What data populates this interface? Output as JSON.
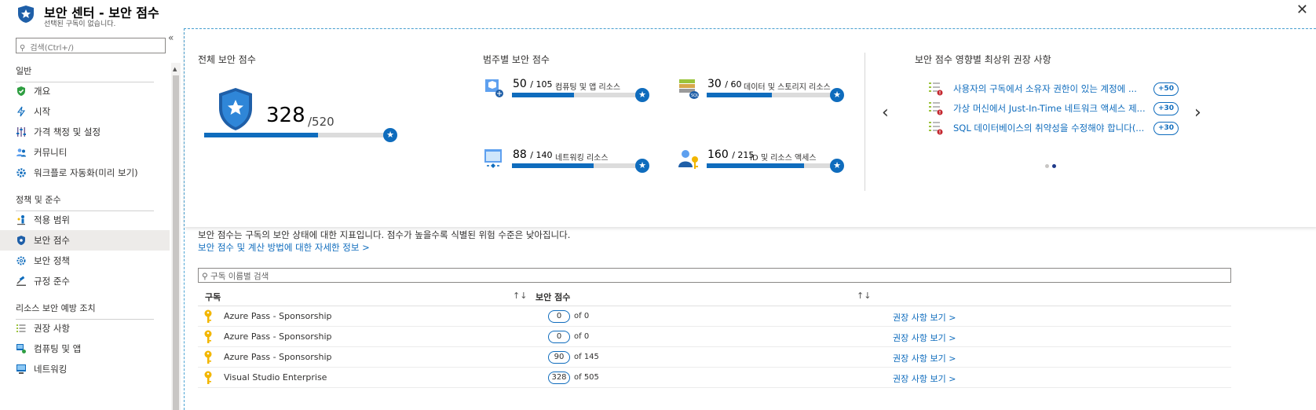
{
  "header": {
    "title": "보안 센터 - 보안 점수",
    "subtitle": "선택된 구독이 없습니다.",
    "close": "✕"
  },
  "sidebar": {
    "search_placeholder": "검색(Ctrl+/)",
    "collapse": "«",
    "sections": [
      {
        "label": "일반",
        "items": [
          "개요",
          "시작",
          "가격 책정 및 설정",
          "커뮤니티",
          "워크플로 자동화(미리 보기)"
        ]
      },
      {
        "label": "정책 및 준수",
        "items": [
          "적용 범위",
          "보안 점수",
          "보안 정책",
          "규정 준수"
        ]
      },
      {
        "label": "리소스 보안 예방 조치",
        "items": [
          "권장 사항",
          "컴퓨팅 및 앱",
          "네트워킹"
        ]
      }
    ],
    "active_item": "보안 점수"
  },
  "overall": {
    "title": "전체 보안 점수",
    "score": "328",
    "max": "/520",
    "progress": 0.631
  },
  "categories": {
    "title": "범주별 보안 점수",
    "items": [
      {
        "score": "50",
        "max": "/ 105",
        "name": "컴퓨팅 및 앱 리소스",
        "progress": 0.476
      },
      {
        "score": "30",
        "max": "/ 60",
        "name": "데이터 및 스토리지 리소스",
        "progress": 0.5
      },
      {
        "score": "88",
        "max": "/ 140",
        "name": "네트워킹 리소스",
        "progress": 0.629
      },
      {
        "score": "160",
        "max": "/ 215",
        "name": "ID 및 리소스 액세스",
        "progress": 0.744
      }
    ]
  },
  "recommendations": {
    "title": "보안 점수 영향별 최상위 권장 사항",
    "items": [
      {
        "text": "사용자의 구독에서 소유자 권한이 있는 계정에 ...",
        "impact": "+50"
      },
      {
        "text": "가상 머신에서 Just-In-Time 네트워크 액세스 제...",
        "impact": "+30"
      },
      {
        "text": "SQL 데이터베이스의 취약성을 수정해야 합니다(...",
        "impact": "+30"
      }
    ],
    "prev": "‹",
    "next": "›"
  },
  "description": {
    "line1": "보안 점수는 구독의 보안 상태에 대한 지표입니다. 점수가 높을수록 식별된 위험 수준은 낮아집니다.",
    "link": "보안 점수 및 계산 방법에 대한 자세한 정보 >"
  },
  "table": {
    "filter_placeholder": "구독 이름별 검색",
    "col_subscription": "구독",
    "col_score": "보안 점수",
    "sort": "↑↓",
    "rows": [
      {
        "name": "Azure Pass - Sponsorship",
        "score": "0",
        "of": "of 0",
        "link": "권장 사항 보기 >"
      },
      {
        "name": "Azure Pass - Sponsorship",
        "score": "0",
        "of": "of 0",
        "link": "권장 사항 보기 >"
      },
      {
        "name": "Azure Pass - Sponsorship",
        "score": "90",
        "of": "of 145",
        "link": "권장 사항 보기 >"
      },
      {
        "name": "Visual Studio Enterprise",
        "score": "328",
        "of": "of 505",
        "link": "권장 사항 보기 >"
      }
    ]
  },
  "colors": {
    "accent": "#0f6cbd",
    "key": "#f2b600"
  }
}
